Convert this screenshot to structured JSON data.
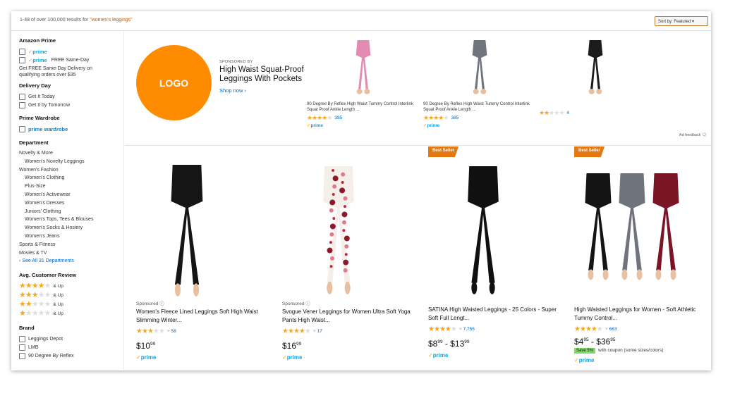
{
  "results_header": {
    "prefix": "1-48 of over 100,000 results for ",
    "query": "\"women's leggings\"",
    "sort_label": "Sort by: Featured"
  },
  "sidebar": {
    "prime": {
      "heading": "Amazon Prime",
      "prime_label": "prime",
      "sameday_label": "FREE Same-Day",
      "sameday_note": "Get FREE Same-Day Delivery on qualifying orders over $35"
    },
    "delivery": {
      "heading": "Delivery Day",
      "items": [
        "Get It Today",
        "Get It by Tomorrow"
      ]
    },
    "wardrobe": {
      "heading": "Prime Wardrobe",
      "label": "prime wardrobe"
    },
    "department": {
      "heading": "Department",
      "items": [
        {
          "label": "Novelty & More",
          "sub": false
        },
        {
          "label": "Women's Novelty Leggings",
          "sub": true
        },
        {
          "label": "Women's Fashion",
          "sub": false
        },
        {
          "label": "Women's Clothing",
          "sub": true
        },
        {
          "label": "Plus-Size",
          "sub": true
        },
        {
          "label": "Women's Activewear",
          "sub": true
        },
        {
          "label": "Women's Dresses",
          "sub": true
        },
        {
          "label": "Juniors' Clothing",
          "sub": true
        },
        {
          "label": "Women's Tops, Tees & Blouses",
          "sub": true
        },
        {
          "label": "Women's Socks & Hosiery",
          "sub": true
        },
        {
          "label": "Women's Jeans",
          "sub": true
        },
        {
          "label": "Sports & Fitness",
          "sub": false
        },
        {
          "label": "Movies & TV",
          "sub": false
        }
      ],
      "see_all": "‹ See All 31 Departments"
    },
    "review": {
      "heading": "Avg. Customer Review",
      "and_up": "& Up",
      "levels": [
        4,
        3,
        2,
        1
      ]
    },
    "brand": {
      "heading": "Brand",
      "items": [
        "Leggings Depot",
        "LMB",
        "90 Degree By Reflex"
      ]
    }
  },
  "sponsored_brand": {
    "logo_text": "LOGO",
    "tag": "SPONSORED BY",
    "headline": "High Waist Squat-Proof Leggings With Pockets",
    "shop_now": "Shop now ›",
    "products": [
      {
        "title": "90 Degree By Reflex High Waist Tummy Control Interlink Squat Proof Ankle Length ...",
        "rating": 4.5,
        "reviews": "385",
        "prime": "prime",
        "color": "#e38bb5"
      },
      {
        "title": "90 Degree By Reflex High Waist Tummy Control Interlink Squat Proof Ankle Length ...",
        "rating": 4.5,
        "reviews": "385",
        "prime": "prime",
        "color": "#70757d"
      },
      {
        "title": "",
        "rating": 2.5,
        "reviews": "4",
        "prime": "",
        "color": "#1c1c1c"
      }
    ],
    "feedback": "Ad feedback"
  },
  "products": [
    {
      "badge": "",
      "sponsored": "Sponsored ⓘ",
      "title": "Women's Fleece Lined Leggings Soft High Waist Slimming Winter...",
      "rating": 3.5,
      "reviews": "58",
      "price_main": "$10",
      "price_cents": "99",
      "price_to": "",
      "price_to_cents": "",
      "coupon": "",
      "coupon_note": "",
      "prime": "prime",
      "style": "black-single"
    },
    {
      "badge": "",
      "sponsored": "Sponsored ⓘ",
      "title": "Svogue Vener Leggings for Women Ultra Soft Yoga Pants High Waist...",
      "rating": 4.5,
      "reviews": "17",
      "price_main": "$16",
      "price_cents": "99",
      "price_to": "",
      "price_to_cents": "",
      "coupon": "",
      "coupon_note": "",
      "prime": "prime",
      "style": "floral"
    },
    {
      "badge": "Best Seller",
      "sponsored": "",
      "title": "SATINA High Waisted Leggings - 25 Colors - Super Soft Full Lengt...",
      "rating": 4.5,
      "reviews": "7,755",
      "price_main": "$8",
      "price_cents": "99",
      "price_to": " - $13",
      "price_to_cents": "99",
      "coupon": "",
      "coupon_note": "",
      "prime": "prime",
      "style": "black-heels"
    },
    {
      "badge": "Best Seller",
      "sponsored": "",
      "title": "High Waisted Leggings for Women - Soft Athletic Tummy Control...",
      "rating": 4.5,
      "reviews": "663",
      "price_main": "$4",
      "price_cents": "95",
      "price_to": " - $36",
      "price_to_cents": "95",
      "coupon": "Save 5%",
      "coupon_note": "with coupon (some sizes/colors)",
      "prime": "prime",
      "style": "trio"
    }
  ],
  "colors": {
    "accent": "#ff8c00",
    "badge": "#e47911",
    "link": "#0066c0",
    "prime": "#00a8e1",
    "star": "#f5a623",
    "query": "#c45500"
  }
}
